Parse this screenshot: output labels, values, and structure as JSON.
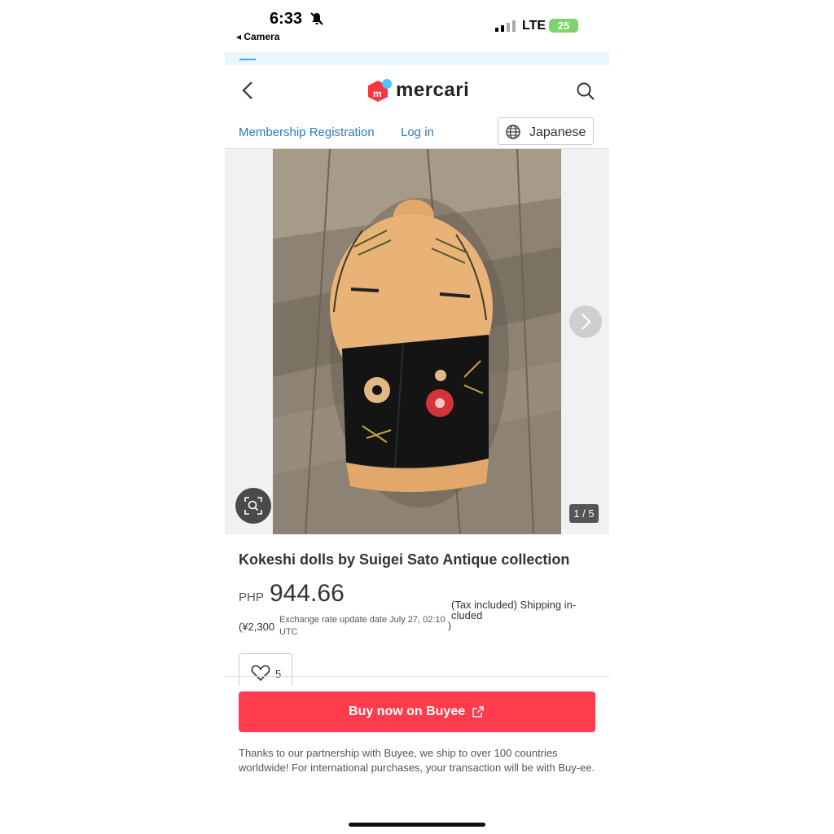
{
  "status_bar": {
    "time": "6:33",
    "back_app": "◂ Camera",
    "network": "LTE",
    "battery": "25"
  },
  "banner": {
    "text": "· · · · · · · · · · · · · · · · · · · · · · · · · · · · · · · ·"
  },
  "header": {
    "logo_text": "mercari"
  },
  "nav_links": {
    "register": "Membership Registration",
    "login": "Log in",
    "language": "Japanese"
  },
  "gallery": {
    "counter": "1 / 5"
  },
  "product": {
    "title": "Kokeshi dolls by Suigei Sato Antique collection",
    "currency": "PHP",
    "price": "944.66",
    "yen": "(¥2,300",
    "rate_note": "Exchange rate update date July 27, 02:10 UTC",
    "rate_close": ")",
    "tax_note": "(Tax included) Shipping in-cluded",
    "likes": "5"
  },
  "buy": {
    "label": "Buy now on Buyee"
  },
  "note": "Thanks to our partnership with Buyee, we ship to over 100 countries worldwide! For international purchases, your transaction will be with Buy-ee.",
  "colors": {
    "accent": "#ff3c4d",
    "link": "#2a7bc1",
    "brand_red": "#ff333f",
    "brand_blue": "#4dc3ff"
  }
}
